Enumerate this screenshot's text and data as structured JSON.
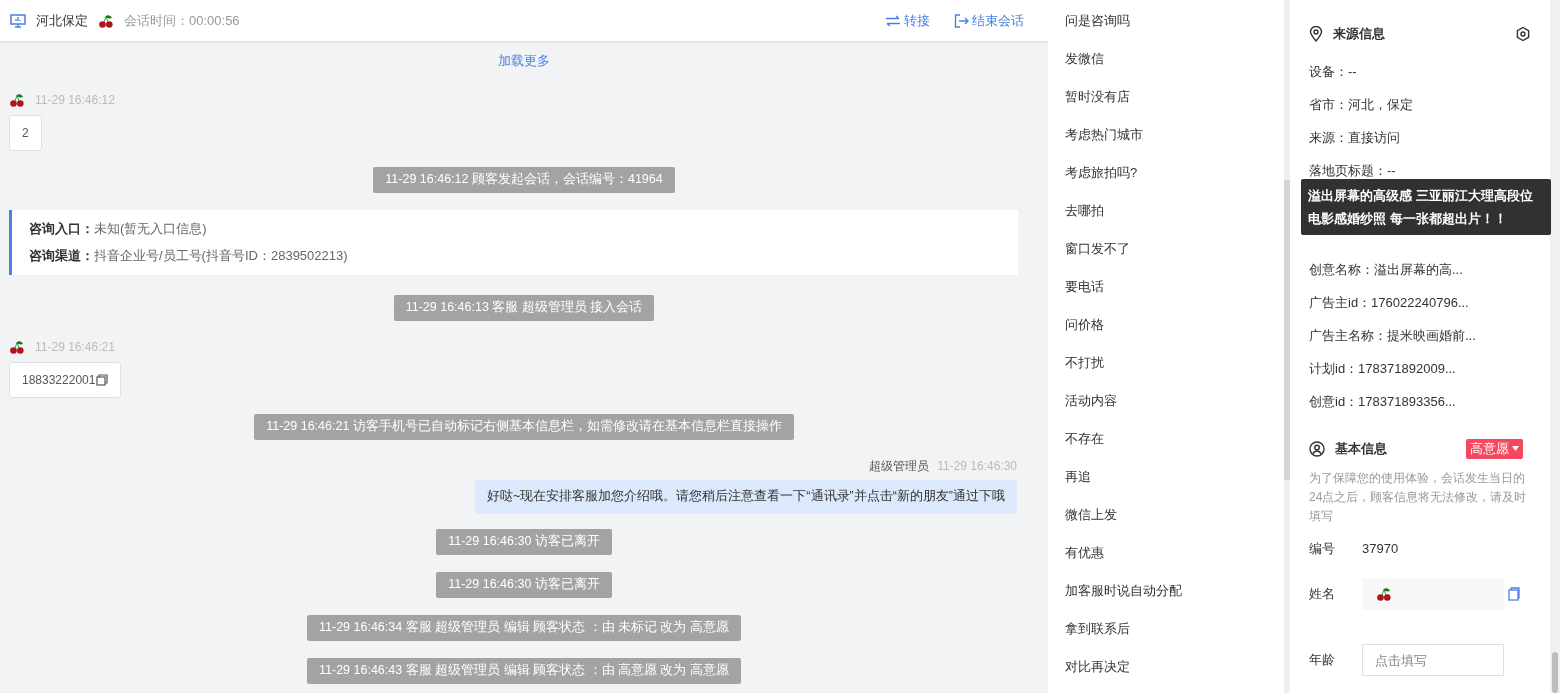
{
  "header": {
    "location": "河北保定",
    "session_time": "会话时间：00:00:56",
    "actions": [
      {
        "kind": "transfer",
        "label": "转接"
      },
      {
        "kind": "end",
        "label": "结束会话"
      }
    ]
  },
  "load_more": "加载更多",
  "messages": [
    {
      "kind": "customer",
      "time": "11-29 16:46:12",
      "text": "2",
      "copy": false
    },
    {
      "kind": "system",
      "text": "11-29 16:46:12 顾客发起会话，会话编号：41964"
    },
    {
      "kind": "entry",
      "lines": [
        {
          "label": "咨询入口：",
          "value": "未知(暂无入口信息)"
        },
        {
          "label": "咨询渠道：",
          "value": "抖音企业号/员工号(抖音号ID：2839502213)"
        }
      ]
    },
    {
      "kind": "system",
      "text": "11-29 16:46:13 客服 超级管理员 接入会话"
    },
    {
      "kind": "customer",
      "time": "11-29 16:46:21",
      "text": "18833222001",
      "copy": true
    },
    {
      "kind": "system",
      "text": "11-29 16:46:21 访客手机号已自动标记右侧基本信息栏，如需修改请在基本信息栏直接操作"
    },
    {
      "kind": "agent",
      "name": "超级管理员",
      "time": "11-29 16:46:30",
      "text": "好哒~现在安排客服加您介绍哦。请您稍后注意查看一下“通讯录”并点击“新的朋友”通过下哦"
    },
    {
      "kind": "system",
      "text": "11-29 16:46:30 访客已离开"
    },
    {
      "kind": "system",
      "text": "11-29 16:46:30 访客已离开"
    },
    {
      "kind": "system",
      "text": "11-29 16:46:34 客服 超级管理员 编辑 顾客状态 ：由 未标记 改为 高意愿"
    },
    {
      "kind": "system",
      "text": "11-29 16:46:43 客服 超级管理员 编辑 顾客状态 ：由 高意愿 改为 高意愿"
    }
  ],
  "quick_replies": [
    "问是咨询吗",
    "发微信",
    "暂时没有店",
    "考虑热门城市",
    "考虑旅拍吗?",
    "去哪拍",
    "窗口发不了",
    "要电话",
    "问价格",
    "不打扰",
    "活动内容",
    "不存在",
    "再追",
    "微信上发",
    "有优惠",
    "加客服时说自动分配",
    "拿到联系后",
    "对比再决定"
  ],
  "source_info": {
    "title": "来源信息",
    "rows_top": [
      "设备：--",
      "省市：河北，保定",
      "来源：直接访问",
      "落地页标题：--"
    ],
    "tooltip": "溢出屏幕的高级感 三亚丽江大理高段位电影感婚纱照 每一张都超出片！！",
    "rows_bottom": [
      "创意名称：溢出屏幕的高...",
      "广告主id：176022240796...",
      "广告主名称：提米映画婚前...",
      "计划id：178371892009...",
      "创意id：178371893356..."
    ]
  },
  "basic_info": {
    "title": "基本信息",
    "status_tag": "高意愿",
    "notice": "为了保障您的使用体验，会话发生当日的24点之后，顾客信息将无法修改，请及时填写",
    "fields": [
      {
        "kind": "text",
        "label": "编号",
        "value": "37970"
      },
      {
        "kind": "avatar",
        "label": "姓名"
      },
      {
        "kind": "input",
        "label": "年龄",
        "placeholder": "点击填写"
      }
    ]
  }
}
